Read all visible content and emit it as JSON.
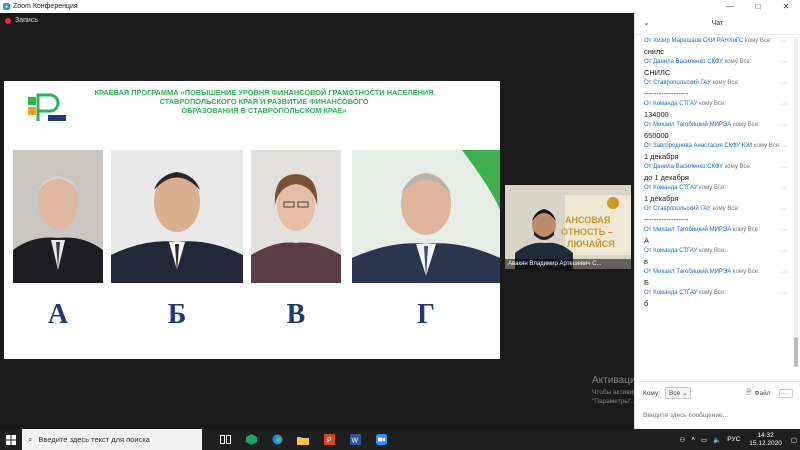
{
  "window": {
    "title": "Zoom Конференция",
    "minimize": "—",
    "restore": "□",
    "close": "✕"
  },
  "recording": {
    "label": "Запись"
  },
  "slide": {
    "title_lines": [
      "КРАЕВАЯ ПРОГРАММА «ПОВЫШЕНИЕ УРОВНЯ ФИНАНСОВОЙ ГРАМОТНОСТИ НАСЕЛЕНИЯ",
      "СТАВРОПОЛЬСКОГО КРАЯ И РАЗВИТИЕ ФИНАНСОВОГО",
      "ОБРАЗОВАНИЯ В СТАВРОПОЛЬСКОМ КРАЕ»"
    ],
    "letters": [
      "А",
      "Б",
      "В",
      "Г"
    ]
  },
  "participant": {
    "name": "Авакян Владимир Артешевич С..."
  },
  "watermark": {
    "line1": "Активация Windows",
    "line2": "Чтобы активировать Windows, перейдите в раздел \"Параметры\"."
  },
  "chat": {
    "title": "Чат",
    "messages": [
      {
        "from": "От Хизир Марешаов СКИ РАНХиГС",
        "to": "кому Все:",
        "text": "снилс"
      },
      {
        "from": "От Данила Василенко СКФУ",
        "to": "кому Все:",
        "text": "СНИЛС"
      },
      {
        "from": "От Ставропольский ГАУ",
        "to": "кому Все:",
        "text": "------------------"
      },
      {
        "from": "От Команда СТГАУ",
        "to": "кому Все:",
        "text": "134000"
      },
      {
        "from": "От Михаил Тагобицкий МИРЭА",
        "to": "кому Все:",
        "text": "650000"
      },
      {
        "from": "От Завгороднева Анастасия СКФУ ЮИ",
        "to": "кому Все:",
        "text": "1 декабря"
      },
      {
        "from": "От Данила Василенко СКФУ",
        "to": "кому Все:",
        "text": "до 1 декабря"
      },
      {
        "from": "От Команда СТГАУ",
        "to": "кому Все:",
        "text": "1 декабря"
      },
      {
        "from": "От Ставропольский ГАУ",
        "to": "кому Все:",
        "text": "------------------"
      },
      {
        "from": "От Михаил Тагобицкий МИРЭА",
        "to": "кому Все:",
        "text": "А"
      },
      {
        "from": "От Команда СТГАУ",
        "to": "кому Все:",
        "text": "в"
      },
      {
        "from": "От Михаил Тагобицкий МИРЭА",
        "to": "кому Все:",
        "text": "Б"
      },
      {
        "from": "От Команда СТГАУ",
        "to": "кому Все:",
        "text": "б"
      }
    ],
    "to_label": "Кому:",
    "to_value": "Все",
    "file_label": "Файл",
    "more_label": "···",
    "input_placeholder": "Введите здесь сообщение..."
  },
  "taskbar": {
    "search_placeholder": "Введите здесь текст для поиска",
    "lang": "РУС",
    "time": "14:32",
    "date": "15.12.2020"
  },
  "colors": {
    "slide_title": "#2fb35a",
    "letters": "#1f3a7a",
    "chat_sender": "#1a6ce0",
    "zoom_blue": "#2D8CFF"
  }
}
